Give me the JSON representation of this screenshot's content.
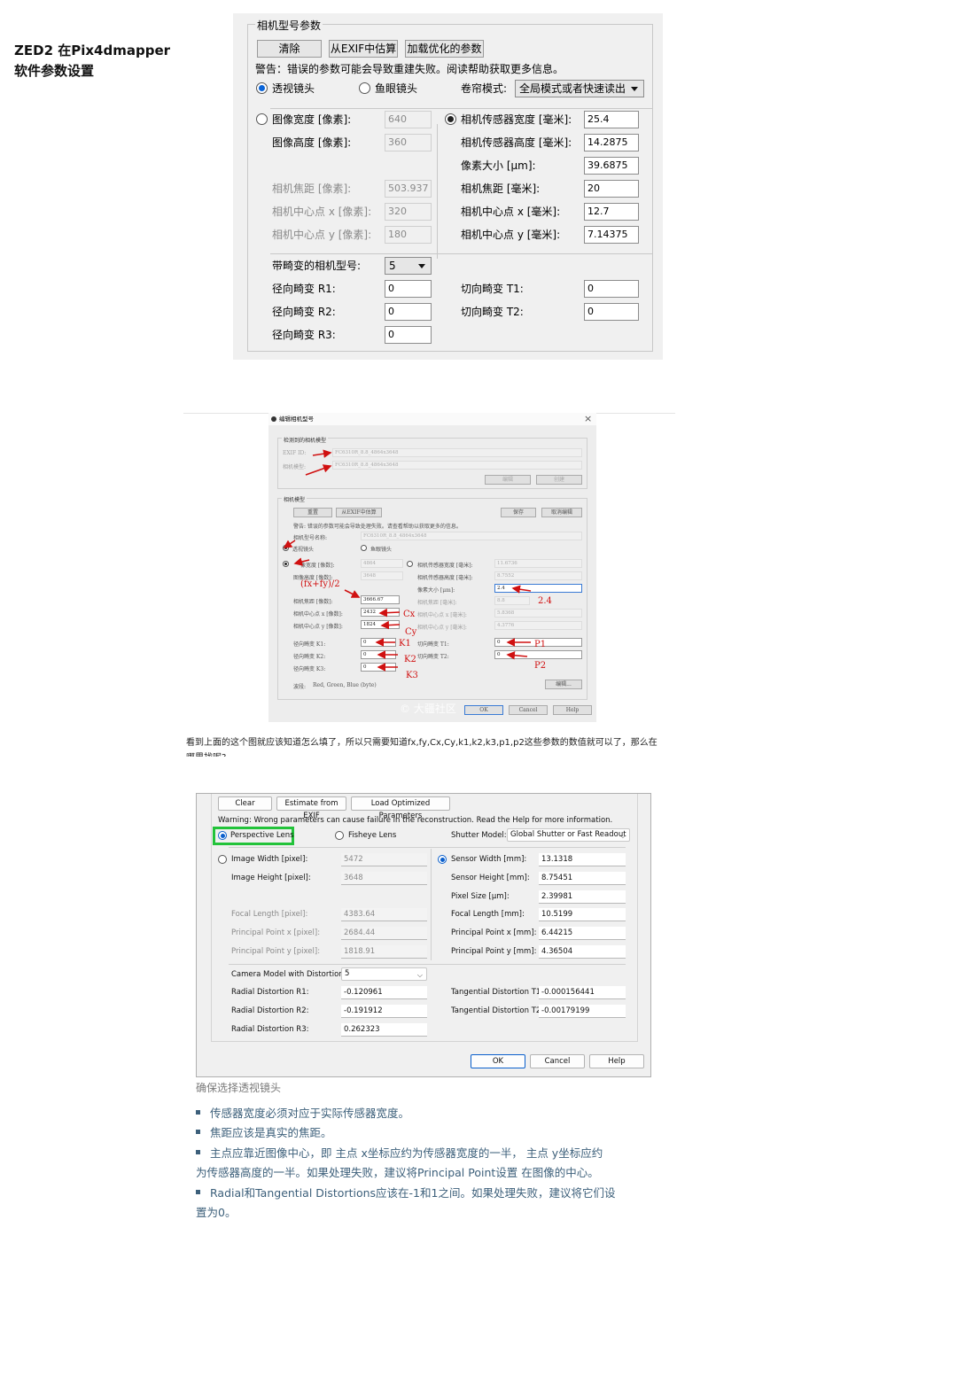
{
  "page": {
    "title": "ZED2 在Pix4dmapper软件参数设置"
  },
  "dlg1": {
    "legend": "相机型号参数",
    "btn_clear": "清除",
    "btn_exif": "从EXIF中估算",
    "btn_load": "加载优化的参数",
    "warning": "警告：错误的参数可能会导致重建失败。阅读帮助获取更多信息。",
    "lens_persp": "透视镜头",
    "lens_fish": "鱼眼镜头",
    "shutter_label": "卷帘模式:",
    "shutter_value": "全局模式或者快速读出",
    "img_width_label": "图像宽度 [像素]:",
    "img_width": "640",
    "img_height_label": "图像高度 [像素]:",
    "img_height": "360",
    "focal_px_label": "相机焦距 [像素]:",
    "focal_px": "503.937",
    "cx_px_label": "相机中心点 x [像素]:",
    "cx_px": "320",
    "cy_px_label": "相机中心点 y [像素]:",
    "cy_px": "180",
    "sensor_w_label": "相机传感器宽度 [毫米]:",
    "sensor_w": "25.4",
    "sensor_h_label": "相机传感器高度 [毫米]:",
    "sensor_h": "14.2875",
    "pixel_label": "像素大小 [μm]:",
    "pixel": "39.6875",
    "focal_mm_label": "相机焦距 [毫米]:",
    "focal_mm": "20",
    "cx_mm_label": "相机中心点 x [毫米]:",
    "cx_mm": "12.7",
    "cy_mm_label": "相机中心点 y [毫米]:",
    "cy_mm": "7.14375",
    "model_label": "带畸变的相机型号:",
    "model": "5",
    "r1_label": "径向畸变 R1:",
    "r1": "0",
    "r2_label": "径向畸变 R2:",
    "r2": "0",
    "r3_label": "径向畸变 R3:",
    "r3": "0",
    "t1_label": "切向畸变 T1:",
    "t1": "0",
    "t2_label": "切向畸变 T2:",
    "t2": "0"
  },
  "dlg2": {
    "title": "编辑相机型号",
    "close": "×",
    "sec1": "检测到的相机模型",
    "exif_label": "EXIF ID:",
    "exif": "FC6310R_8.8_4864x3648",
    "model_label": "相机模型:",
    "model": "FC6310R_8.8_4864x3648",
    "btn_edit": "编辑",
    "btn_create": "创建",
    "sec2": "相机模型",
    "btn_reset": "重置",
    "btn_exif": "从EXIF中估算",
    "btn_save": "保存",
    "btn_cancel_edit": "取消编辑",
    "warning": "警告: 错误的参数可能会导致处理失败。请查看帮助以获取更多的信息。",
    "name_label": "相机型号名称:",
    "name": "FC6310R_8.8_4864x3648",
    "persp": "透视镜头",
    "fish": "鱼眼镜头",
    "w_label": "像宽度 [像数]:",
    "w": "4864",
    "h_label": "图像高度 [像数]:",
    "h": "3648",
    "f_label": "相机焦距 [像数]:",
    "f": "3666.67",
    "cx_label": "相机中心点 x [像数]:",
    "cx": "2432",
    "cy_label": "相机中心点 y [像数]:",
    "cy": "1824",
    "sw_label": "相机传感器宽度 [毫米]:",
    "sw": "11.6736",
    "sh_label": "相机传感器高度 [毫米]:",
    "sh": "8.7552",
    "px_label": "像素大小 [μm]:",
    "px": "2.4",
    "fmm_label": "相机焦距 [毫米]:",
    "fmm": "8.8",
    "cxmm_label": "相机中心点 x [毫米]:",
    "cxmm": "5.8368",
    "cymm_label": "相机中心点 y [毫米]:",
    "cymm": "4.3776",
    "k1_label": "径向畸变 K1:",
    "k1": "0",
    "k2_label": "径向畸变 K2:",
    "k2": "0",
    "k3_label": "径向畸变 K3:",
    "k3": "0",
    "t1_label": "切向畸变 T1:",
    "t1": "0",
    "t2_label": "切向畸变 T2:",
    "t2": "0",
    "band_label": "波段:",
    "band": "Red, Green, Blue (byte)",
    "btn_editdots": "编辑...",
    "btn_ok": "OK",
    "btn_cancel": "Cancel",
    "btn_help": "Help",
    "watermark": "© 大疆社区",
    "ann_fxfy": "(fx+fy)/2",
    "ann_24": "2.4",
    "ann_cx": "Cx",
    "ann_cy": "Cy",
    "ann_k1": "K1",
    "ann_k2": "K2",
    "ann_k3": "K3",
    "ann_p1": "P1",
    "ann_p2": "P2"
  },
  "desc": "看到上面的这个图就应该知道怎么填了，所以只需要知道fx,fy,Cx,Cy,k1,k2,k3,p1,p2这些参数的数值就可以了，那么在",
  "desc_cut": "哪里找呢?",
  "dlg3": {
    "btn_clear": "Clear",
    "btn_exif": "Estimate from EXIF",
    "btn_load": "Load Optimized Parameters",
    "warning": "Warning: Wrong parameters can cause failure in the reconstruction. Read the Help for more information.",
    "persp": "Perspective Lens",
    "fish": "Fisheye Lens",
    "shutter_label": "Shutter Model:",
    "shutter": "Global Shutter or Fast Readout",
    "iw_label": "Image Width [pixel]:",
    "iw": "5472",
    "ih_label": "Image Height [pixel]:",
    "ih": "3648",
    "fpx_label": "Focal Length [pixel]:",
    "fpx": "4383.64",
    "ppx_label": "Principal Point x [pixel]:",
    "ppx": "2684.44",
    "ppy_label": "Principal Point y [pixel]:",
    "ppy": "1818.91",
    "sw_label": "Sensor Width [mm]:",
    "sw": "13.1318",
    "sh_label": "Sensor Height [mm]:",
    "sh": "8.75451",
    "ps_label": "Pixel Size [μm]:",
    "ps": "2.39981",
    "fmm_label": "Focal Length [mm]:",
    "fmm": "10.5199",
    "pxmm_label": "Principal Point x [mm]:",
    "pxmm": "6.44215",
    "pymm_label": "Principal Point y [mm]:",
    "pymm": "4.36504",
    "model_label": "Camera Model with Distortions:",
    "model": "5",
    "r1_label": "Radial Distortion R1:",
    "r1": "-0.120961",
    "r2_label": "Radial Distortion R2:",
    "r2": "-0.191912",
    "r3_label": "Radial Distortion R3:",
    "r3": "0.262323",
    "t1_label": "Tangential Distortion T1:",
    "t1": "-0.000156441",
    "t2_label": "Tangential Distortion T2:",
    "t2": "-0.00179199",
    "btn_ok": "OK",
    "btn_cancel": "Cancel",
    "btn_help": "Help"
  },
  "caption": "确保选择透视镜头",
  "bullets": {
    "b1": "传感器宽度必须对应于实际传感器宽度。",
    "b2": "焦距应该是真实的焦距。",
    "b3a": "主点应靠近图像中心，即 主点 x坐标应约为传感器宽度的一半， 主点 y坐标应约",
    "b3b": "为传感器高度的一半。如果处理失败，建议将Principal Point设置 在图像的中心。",
    "b4a": "Radial和Tangential Distortions应该在-1和1之间。如果处理失败，建议将它们设",
    "b4b": "置为0。"
  },
  "colors": {
    "accent": "#0a5fcc",
    "highlight": "#22c33a",
    "annotation": "#d01010",
    "bullet_text": "#3c5f7a"
  }
}
